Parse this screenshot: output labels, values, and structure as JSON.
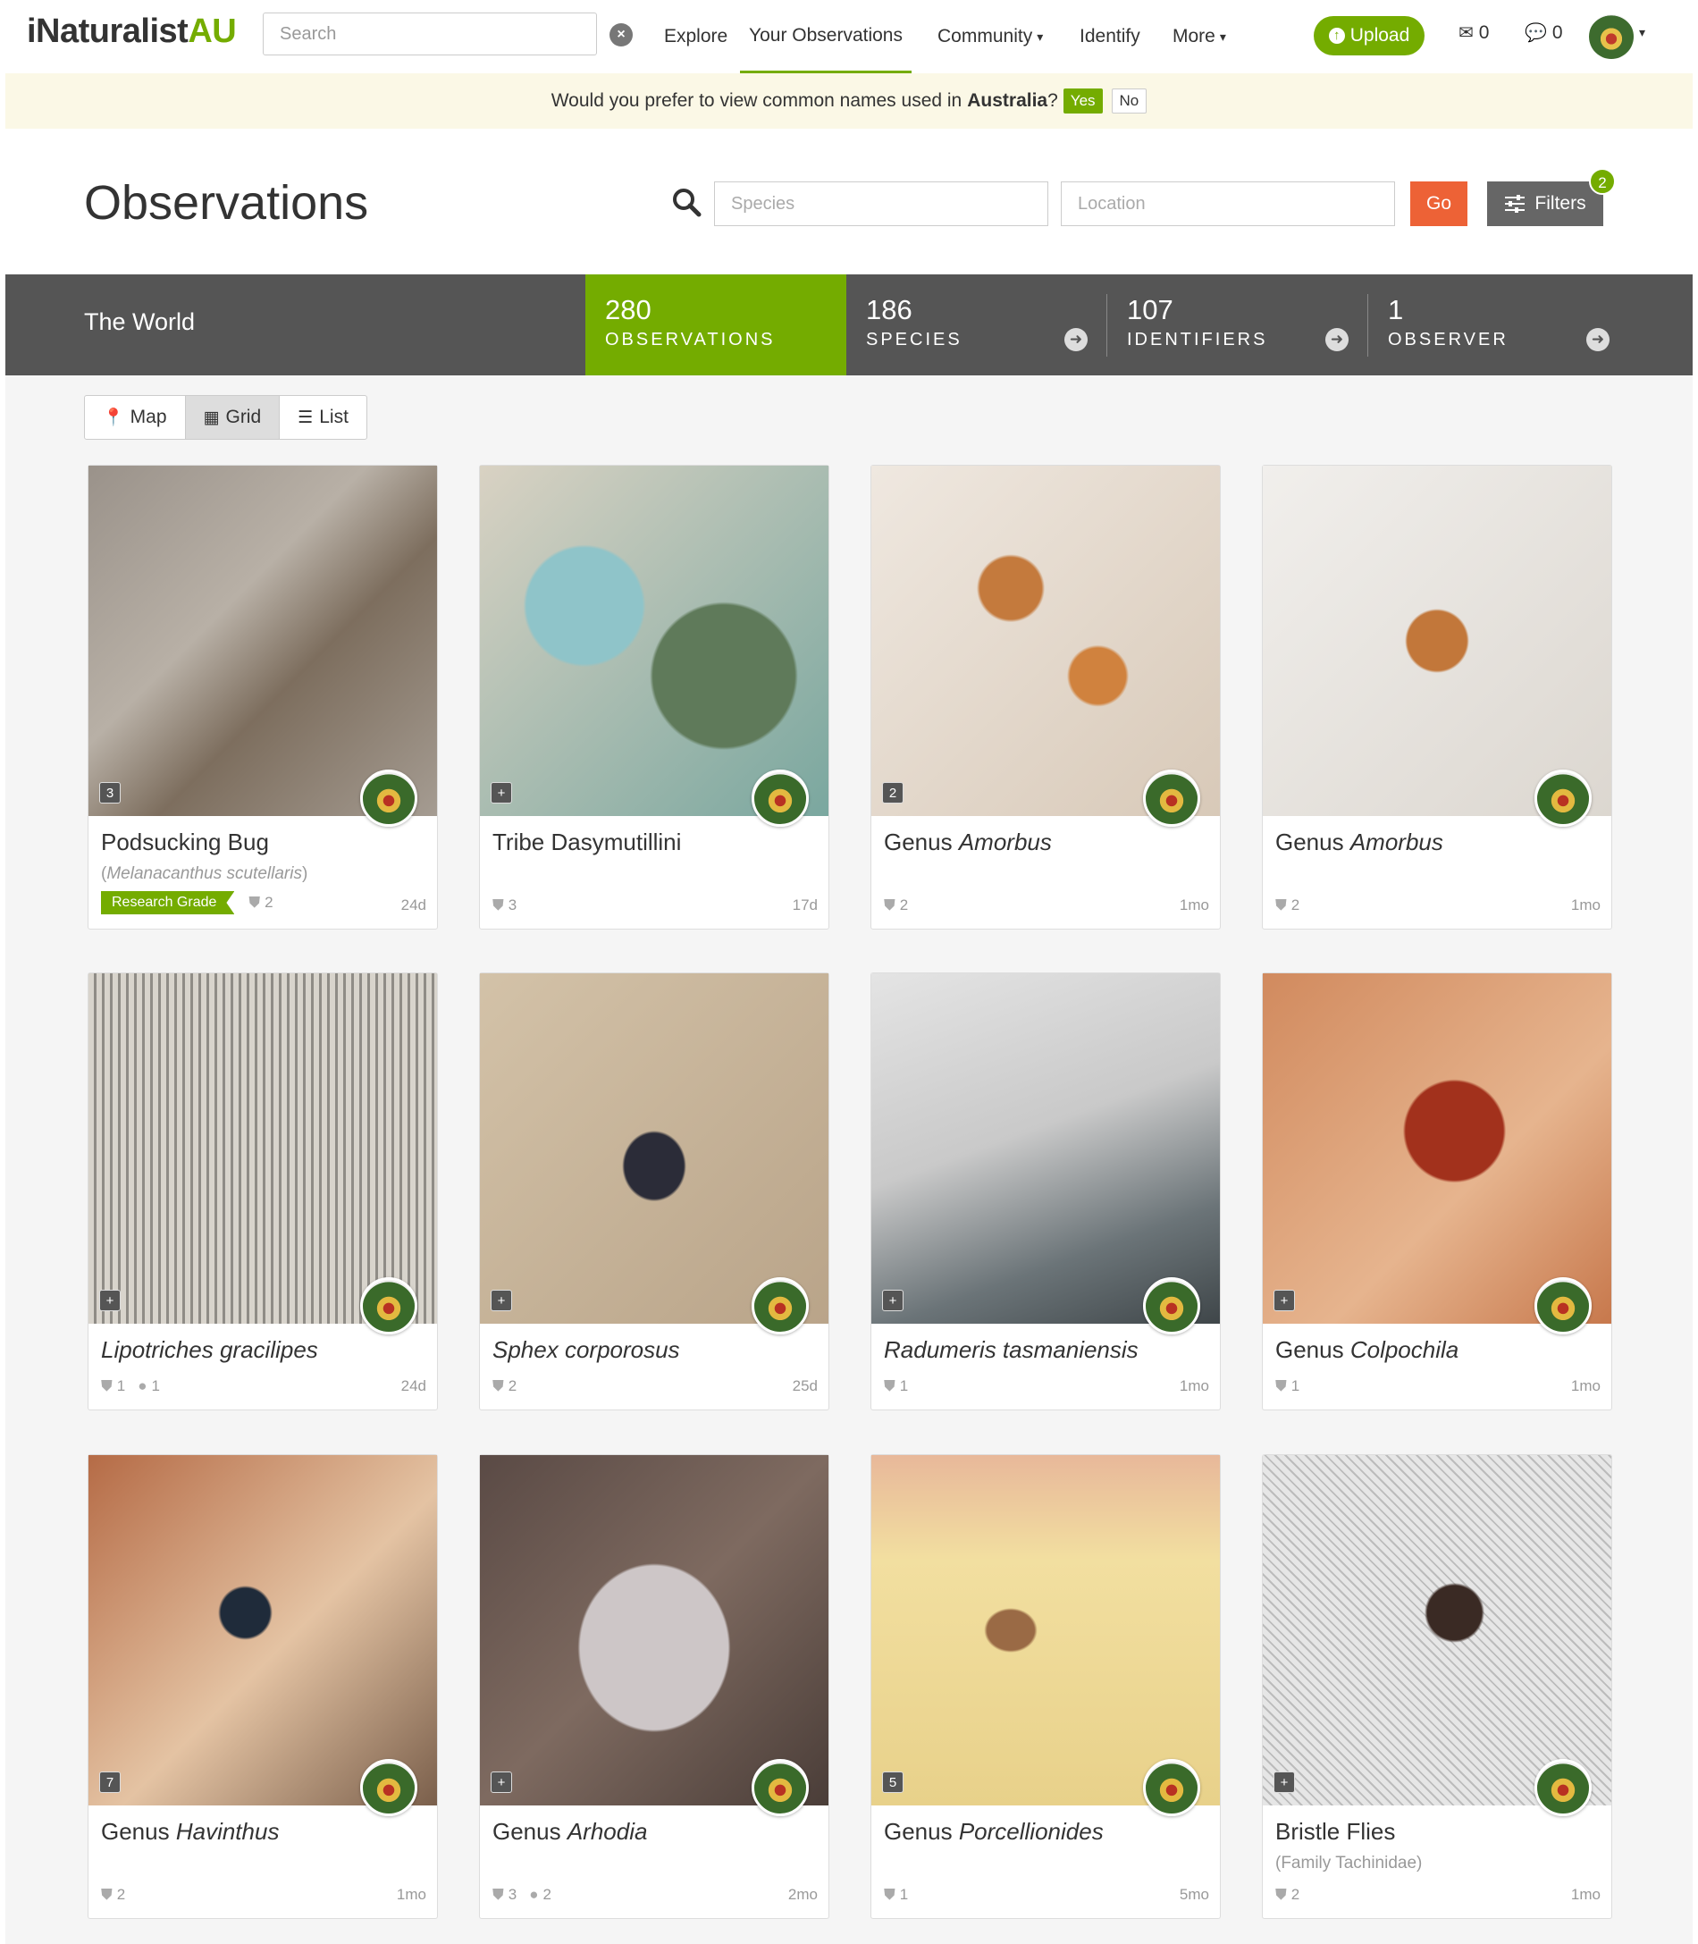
{
  "header": {
    "logo_main": "iNaturalist",
    "logo_accent": "AU",
    "search_placeholder": "Search",
    "nav": {
      "explore": "Explore",
      "your_observations": "Your Observations",
      "community": "Community",
      "identify": "Identify",
      "more": "More"
    },
    "upload_label": "Upload",
    "messages_count": "0",
    "notifications_count": "0"
  },
  "banner": {
    "text": "Would you prefer to view common names used in",
    "place": "Australia",
    "question_mark": "?",
    "yes": "Yes",
    "no": "No"
  },
  "title_row": {
    "title": "Observations",
    "species_placeholder": "Species",
    "location_placeholder": "Location",
    "go": "Go",
    "filters": "Filters",
    "filters_count": "2"
  },
  "stats": {
    "place": "The World",
    "observations": {
      "num": "280",
      "label": "OBSERVATIONS"
    },
    "species": {
      "num": "186",
      "label": "SPECIES"
    },
    "identifiers": {
      "num": "107",
      "label": "IDENTIFIERS"
    },
    "observers": {
      "num": "1",
      "label": "OBSERVER"
    }
  },
  "view_toggle": {
    "map": "Map",
    "grid": "Grid",
    "list": "List"
  },
  "colors": {
    "brand_green": "#74ac00",
    "go_orange": "#ed6236",
    "statsbar": "#555555"
  },
  "observations": [
    {
      "prefix": "Podsucking Bug",
      "italic": "",
      "sub_text": "(",
      "sub_italic": "Melanacanthus scutellaris",
      "sub_end": ")",
      "badge": "3",
      "research_grade": "Research Grade",
      "ids": "2",
      "comments": "",
      "age": "24d"
    },
    {
      "prefix": "Tribe Dasymutillini",
      "italic": "",
      "sub_text": "",
      "sub_italic": "",
      "sub_end": "",
      "badge": "+",
      "research_grade": "",
      "ids": "3",
      "comments": "",
      "age": "17d"
    },
    {
      "prefix": "Genus ",
      "italic": "Amorbus",
      "sub_text": "",
      "sub_italic": "",
      "sub_end": "",
      "badge": "2",
      "research_grade": "",
      "ids": "2",
      "comments": "",
      "age": "1mo"
    },
    {
      "prefix": "Genus ",
      "italic": "Amorbus",
      "sub_text": "",
      "sub_italic": "",
      "sub_end": "",
      "badge": "",
      "research_grade": "",
      "ids": "2",
      "comments": "",
      "age": "1mo"
    },
    {
      "prefix": "",
      "italic": "Lipotriches gracilipes",
      "sub_text": "",
      "sub_italic": "",
      "sub_end": "",
      "badge": "+",
      "research_grade": "",
      "ids": "1",
      "comments": "1",
      "age": "24d"
    },
    {
      "prefix": "",
      "italic": "Sphex corporosus",
      "sub_text": "",
      "sub_italic": "",
      "sub_end": "",
      "badge": "+",
      "research_grade": "",
      "ids": "2",
      "comments": "",
      "age": "25d"
    },
    {
      "prefix": "",
      "italic": "Radumeris tasmaniensis",
      "sub_text": "",
      "sub_italic": "",
      "sub_end": "",
      "badge": "+",
      "research_grade": "",
      "ids": "1",
      "comments": "",
      "age": "1mo"
    },
    {
      "prefix": "Genus ",
      "italic": "Colpochila",
      "sub_text": "",
      "sub_italic": "",
      "sub_end": "",
      "badge": "+",
      "research_grade": "",
      "ids": "1",
      "comments": "",
      "age": "1mo"
    },
    {
      "prefix": "Genus ",
      "italic": "Havinthus",
      "sub_text": "",
      "sub_italic": "",
      "sub_end": "",
      "badge": "7",
      "research_grade": "",
      "ids": "2",
      "comments": "",
      "age": "1mo"
    },
    {
      "prefix": "Genus ",
      "italic": "Arhodia",
      "sub_text": "",
      "sub_italic": "",
      "sub_end": "",
      "badge": "+",
      "research_grade": "",
      "ids": "3",
      "comments": "2",
      "age": "2mo"
    },
    {
      "prefix": "Genus ",
      "italic": "Porcellionides",
      "sub_text": "",
      "sub_italic": "",
      "sub_end": "",
      "badge": "5",
      "research_grade": "",
      "ids": "1",
      "comments": "",
      "age": "5mo"
    },
    {
      "prefix": "Bristle Flies",
      "italic": "",
      "sub_text": "(Family Tachinidae)",
      "sub_italic": "",
      "sub_end": "",
      "badge": "+",
      "research_grade": "",
      "ids": "2",
      "comments": "",
      "age": "1mo"
    }
  ]
}
